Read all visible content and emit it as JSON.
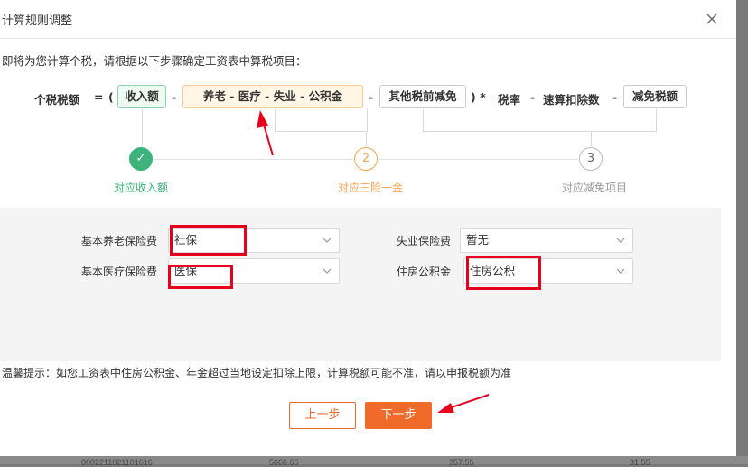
{
  "dialog": {
    "title": "计算规则调整",
    "intro": "即将为您计算个税，请根据以下步骤确定工资表中算税项目："
  },
  "formula": {
    "lhs": "个税税额",
    "eq": "=",
    "open_paren": "(",
    "income": "收入额",
    "minus": "-",
    "insurance": "养老 - 医疗 - 失业 - 公积金",
    "other": "其他税前减免",
    "close_star": ")  *",
    "rate": "税率",
    "quick": "速算扣除数",
    "relief": "减免税额"
  },
  "steps": [
    {
      "number": "✓",
      "label": "对应收入额",
      "state": "done"
    },
    {
      "number": "2",
      "label": "对应三险一金",
      "state": "active"
    },
    {
      "number": "3",
      "label": "对应减免项目",
      "state": "pending"
    }
  ],
  "fields": {
    "pension": {
      "label": "基本养老保险费",
      "value": "社保"
    },
    "medical": {
      "label": "基本医疗保险费",
      "value": "医保"
    },
    "unemployment": {
      "label": "失业保险费",
      "value": "暂无"
    },
    "housing": {
      "label": "住房公积金",
      "value": "住房公积"
    }
  },
  "tip": "温馨提示：如您工资表中住房公积金、年金超过当地设定扣除上限，计算税额可能不准，请以申报税额为准",
  "buttons": {
    "prev": "上一步",
    "next": "下一步"
  },
  "background_row": [
    "0002211021101616",
    "5666.66",
    "357.55",
    "31.55"
  ],
  "colors": {
    "accent": "#f06a2a",
    "done_green": "#3bb37a",
    "active_orange": "#f5a351",
    "annotation_red": "#e6001e"
  }
}
